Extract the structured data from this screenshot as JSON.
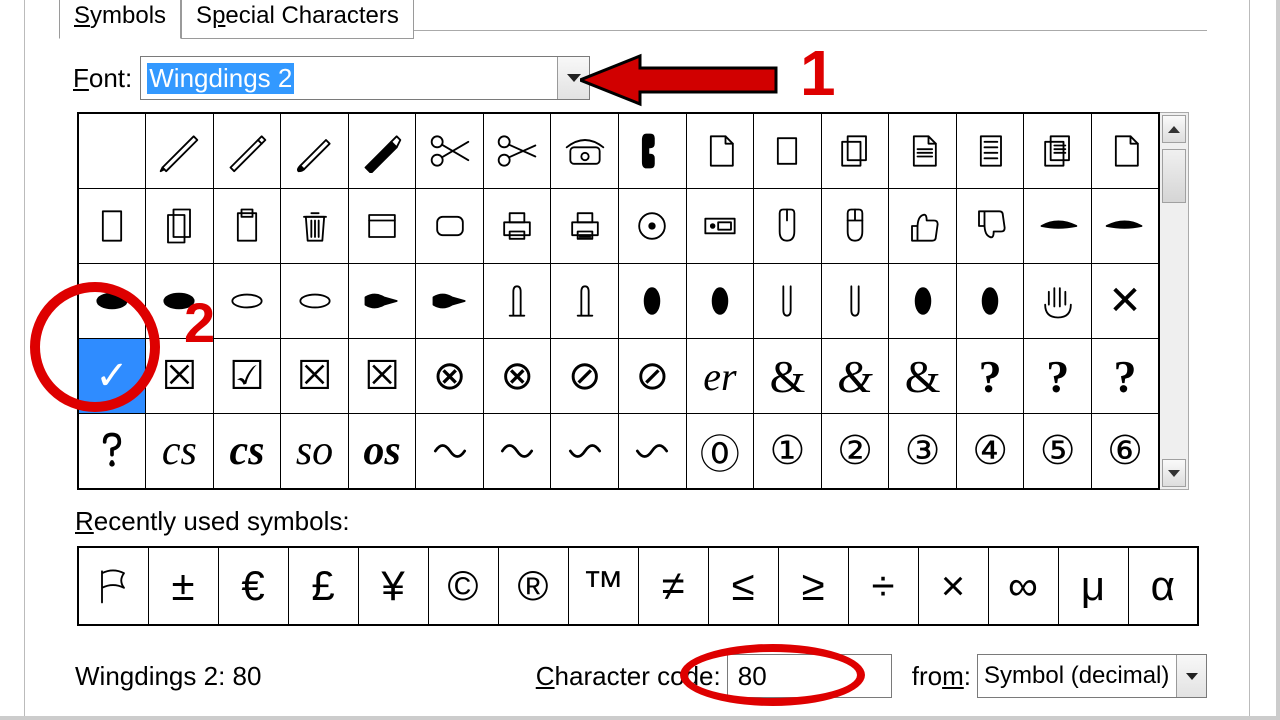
{
  "tabs": {
    "symbols": "Symbols",
    "special": "Special Characters"
  },
  "font": {
    "label": "Font:",
    "value": "Wingdings 2"
  },
  "grid": [
    [
      "",
      "pen1",
      "pen2",
      "brush",
      "marker",
      "scissors1",
      "scissors2",
      "phone",
      "handset",
      "doc1",
      "doc2",
      "docs",
      "doclines1",
      "doclines2",
      "docmulti",
      "docblank"
    ],
    [
      "page",
      "pages",
      "clipboard",
      "trash",
      "window",
      "roundrect",
      "printer1",
      "printer2",
      "disc",
      "hdd",
      "mouse1",
      "mouse2",
      "thumbup",
      "thumbdown",
      "wingL",
      "wingR"
    ],
    [
      "shadowL",
      "shadowR",
      "ovalL",
      "ovalR",
      "pointR1",
      "pointR2",
      "handup1",
      "handup2",
      "fist1",
      "fist2",
      "pointdn1",
      "pointdn2",
      "fist3",
      "fist4",
      "palm",
      "✕"
    ],
    [
      "✓",
      "☒",
      "☑",
      "☒",
      "☒",
      "⊗",
      "⊗",
      "⊘",
      "⊘",
      "er",
      "&",
      "&",
      "&",
      "?",
      "?",
      "?"
    ],
    [
      "question",
      "cs1",
      "cs2",
      "so1",
      "so2",
      "swirl1",
      "swirl2",
      "swirl3",
      "swirl4",
      "⓪",
      "①",
      "②",
      "③",
      "④",
      "⑤",
      "⑥"
    ]
  ],
  "selected": {
    "row": 3,
    "col": 0
  },
  "recentLabel": "Recently used symbols:",
  "recent": [
    "flag",
    "±",
    "€",
    "£",
    "¥",
    "©",
    "®",
    "™",
    "≠",
    "≤",
    "≥",
    "÷",
    "×",
    "∞",
    "μ",
    "α"
  ],
  "status": "Wingdings 2: 80",
  "cc": {
    "label": "Character code:",
    "value": "80"
  },
  "from": {
    "label": "from:",
    "value": "Symbol (decimal)"
  },
  "annotations": {
    "one": "1",
    "two": "2"
  }
}
